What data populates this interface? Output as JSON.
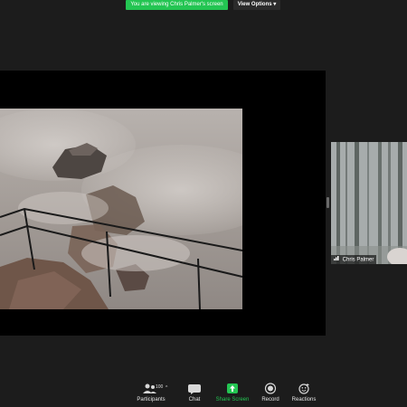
{
  "banner": {
    "viewing_text": "You are viewing Chris Palmer's screen",
    "view_options_label": "View Options",
    "view_options_caret": "▾"
  },
  "participant": {
    "name": "Chris Palmer"
  },
  "toolbar": {
    "participants_label": "Participants",
    "participants_count": "100",
    "participants_caret": "^",
    "chat_label": "Chat",
    "share_screen_label": "Share Screen",
    "record_label": "Record",
    "reactions_label": "Reactions"
  },
  "colors": {
    "accent_green": "#23c552",
    "background": "#1c1c1c",
    "share_background": "#000000"
  },
  "icons": [
    "participants-icon",
    "chat-icon",
    "share-screen-icon",
    "record-icon",
    "reactions-icon",
    "signal-icon"
  ]
}
